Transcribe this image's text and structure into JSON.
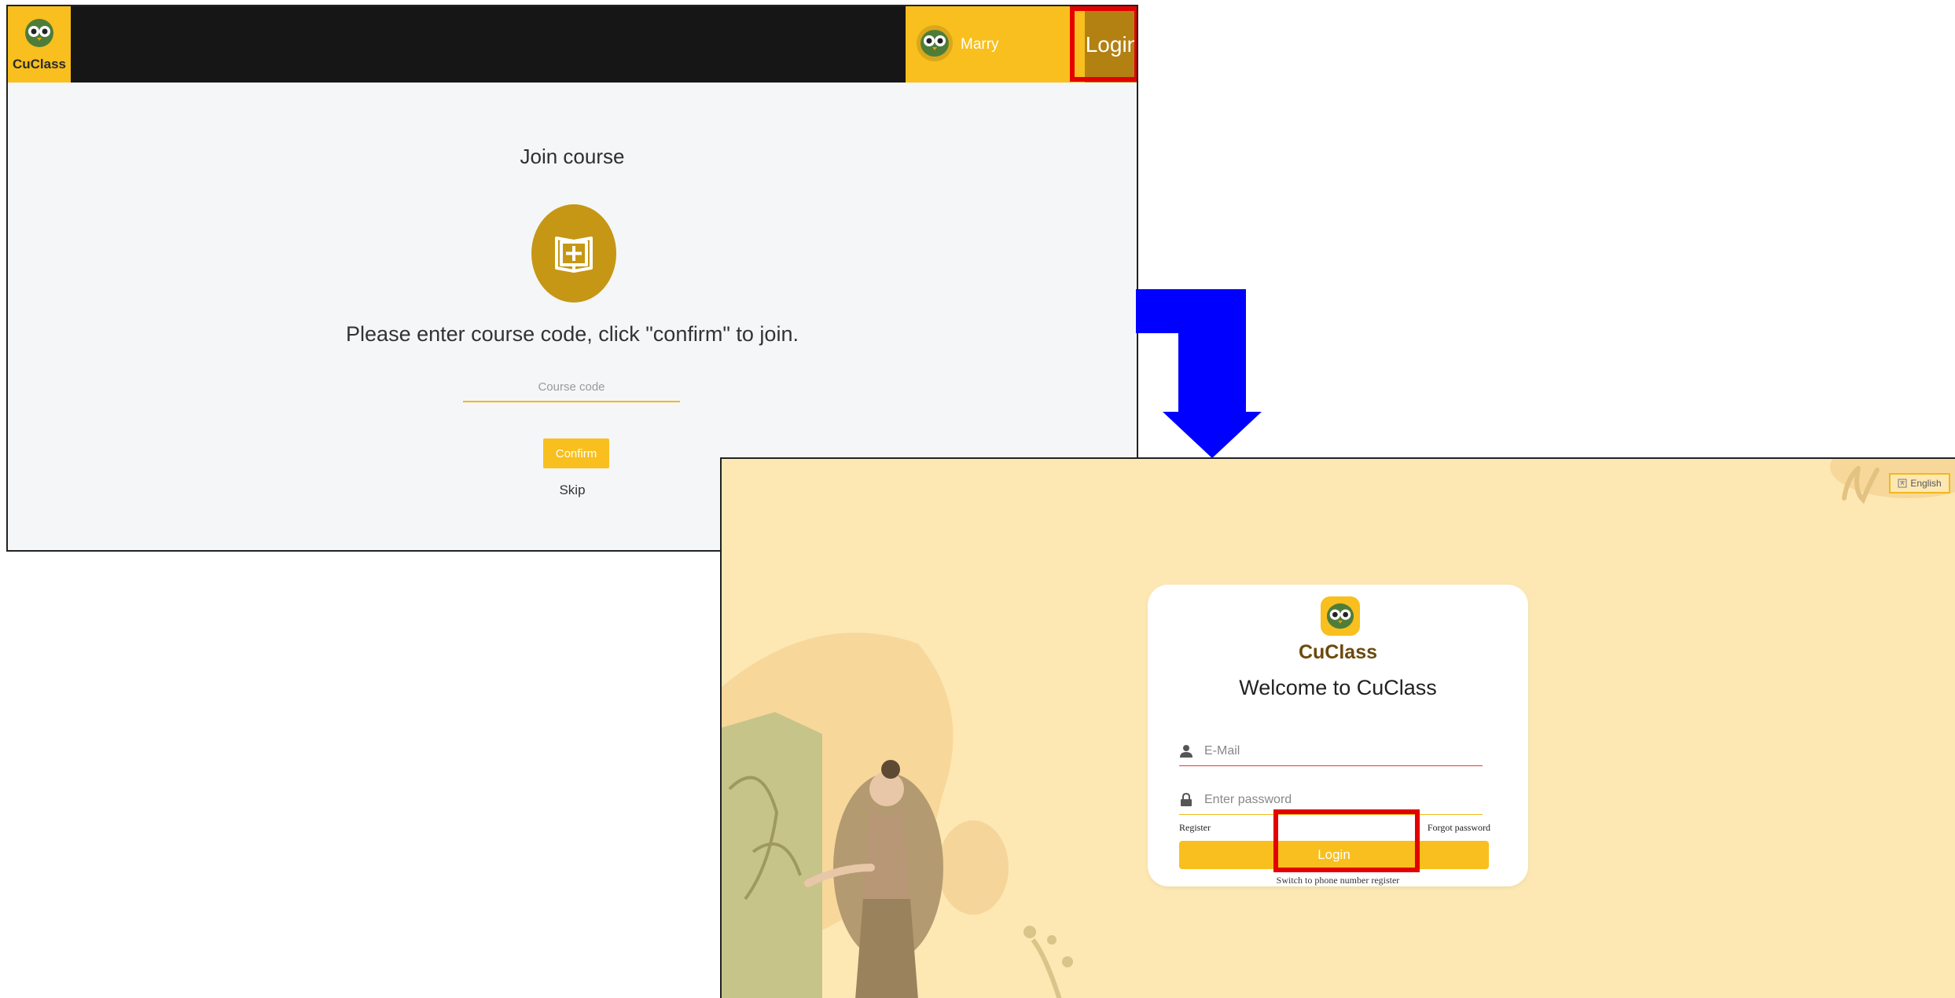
{
  "screen1": {
    "logo_text": "CuClass",
    "username": "Marry",
    "login_label": "Login",
    "title": "Join course",
    "instruction": "Please enter course code, click \"confirm\" to join.",
    "course_code_placeholder": "Course code",
    "confirm_label": "Confirm",
    "skip_label": "Skip"
  },
  "screen2": {
    "language_label": "English",
    "brand": "CuClass",
    "welcome": "Welcome to CuClass",
    "email_placeholder": "E-Mail",
    "password_placeholder": "Enter password",
    "register_label": "Register",
    "forgot_label": "Forgot password",
    "login_label": "Login",
    "switch_label": "Switch to phone number register"
  },
  "colors": {
    "accent": "#f8bf1e",
    "topbar": "#161616",
    "login_dark": "#b38112",
    "highlight": "#e40000",
    "login_bg": "#fde8b4",
    "arrow": "#0000ff"
  },
  "icons": [
    "owl-logo-icon",
    "avatar-icon",
    "book-plus-icon",
    "user-icon",
    "lock-icon",
    "language-icon",
    "arrow-down-icon"
  ]
}
